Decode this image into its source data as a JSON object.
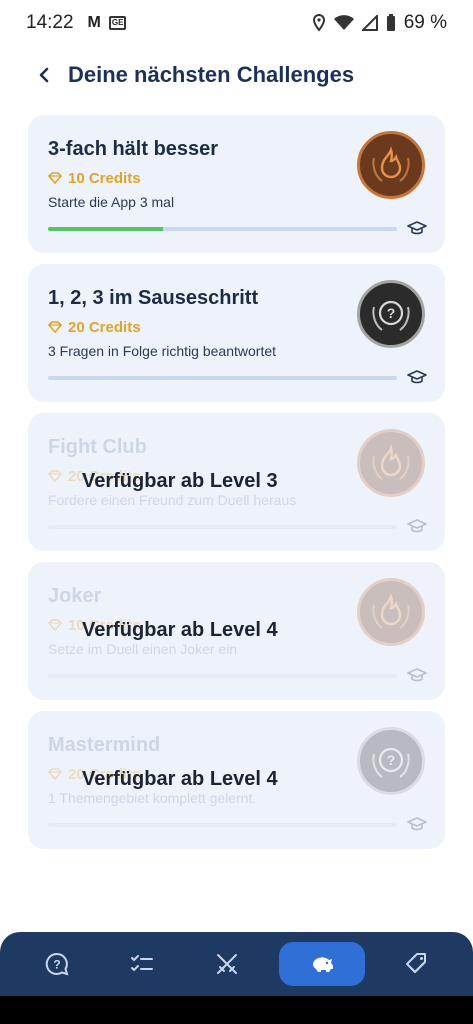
{
  "status_bar": {
    "time": "14:22",
    "battery": "69 %",
    "icons": [
      "gmail-icon",
      "sim-icon",
      "location-icon",
      "wifi-icon",
      "signal-icon",
      "battery-icon"
    ]
  },
  "header": {
    "title": "Deine nächsten Challenges",
    "back_icon": "chevron-left-icon"
  },
  "challenges": [
    {
      "title": "3-fach hält besser",
      "credits": "10 Credits",
      "description": "Starte die App 3 mal",
      "progress": 0.33,
      "badge": "bronze-flame-badge",
      "locked": false
    },
    {
      "title": "1, 2, 3 im Sauseschritt",
      "credits": "20 Credits",
      "description": "3 Fragen in Folge richtig beantwortet",
      "progress": 0,
      "badge": "silver-question-badge",
      "locked": false
    },
    {
      "title": "Fight Club",
      "credits": "20 Credits",
      "description": "Fordere einen Freund zum Duell heraus",
      "progress": 0,
      "badge": "bronze-flame-badge",
      "locked": true,
      "lock_text": "Verfügbar ab Level 3"
    },
    {
      "title": "Joker",
      "credits": "10 Credits",
      "description": "Setze im Duell einen Joker ein",
      "progress": 0,
      "badge": "bronze-flame-badge",
      "locked": true,
      "lock_text": "Verfügbar ab Level 4"
    },
    {
      "title": "Mastermind",
      "credits": "20 Credits",
      "description": "1 Themengebiet komplett gelernt.",
      "progress": 0,
      "badge": "silver-question-badge",
      "locked": true,
      "lock_text": "Verfügbar ab Level 4"
    }
  ],
  "bottom_nav": {
    "items": [
      "question-bubble-icon",
      "checklist-icon",
      "swords-icon",
      "piggy-bank-icon",
      "tags-icon"
    ],
    "active_index": 3
  },
  "colors": {
    "title": "#1d3158",
    "card_bg": "#eef3fb",
    "credits": "#e2a32a",
    "progress_fill": "#58c26a",
    "progress_track": "#c9d7ef",
    "nav_bg": "#1e3a63",
    "nav_active": "#2f6fd6"
  }
}
